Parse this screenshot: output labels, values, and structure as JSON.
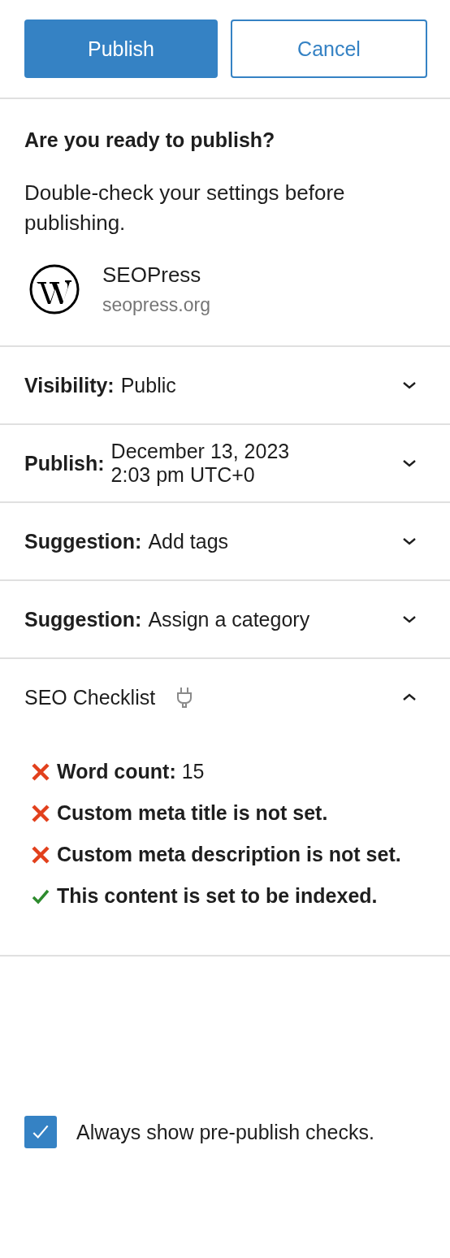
{
  "actions": {
    "primary": "Publish",
    "secondary": "Cancel"
  },
  "intro": {
    "title": "Are you ready to publish?",
    "text": "Double-check your settings before publishing.",
    "site_name": "SEOPress",
    "site_url": "seopress.org"
  },
  "panels": [
    {
      "kind": "row",
      "label": "Visibility:",
      "value": "Public",
      "expanded": false
    },
    {
      "kind": "row",
      "label": "Publish:",
      "value": "December 13, 2023\n2:03 pm UTC+0",
      "expanded": false
    },
    {
      "kind": "row",
      "label": "Suggestion:",
      "value": "Add tags",
      "expanded": false
    },
    {
      "kind": "row",
      "label": "Suggestion:",
      "value": "Assign a category",
      "expanded": false
    },
    {
      "kind": "checklist",
      "label": "SEO Checklist",
      "expanded": true,
      "items": [
        {
          "text": "**Word count:** 15",
          "passed": false
        },
        {
          "text": "**Custom meta title is not set.**",
          "passed": false
        },
        {
          "text": "**Custom meta description is not set.**",
          "passed": false
        },
        {
          "text": "**This content is set to be indexed.**",
          "passed": true
        }
      ]
    }
  ],
  "always_show": {
    "label": "Always show pre-publish checks.",
    "checked": true
  }
}
